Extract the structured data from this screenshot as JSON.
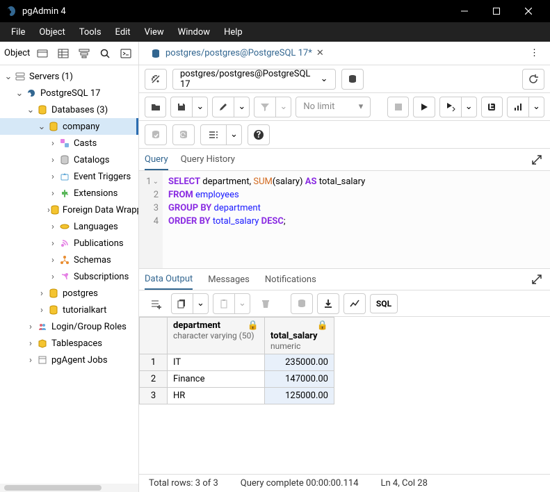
{
  "window": {
    "title": "pgAdmin 4"
  },
  "menu": [
    "File",
    "Object",
    "Tools",
    "Edit",
    "View",
    "Window",
    "Help"
  ],
  "sidebar_label": "Object",
  "tree": {
    "servers": "Servers (1)",
    "pg": "PostgreSQL 17",
    "databases": "Databases (3)",
    "company": "company",
    "casts": "Casts",
    "catalogs": "Catalogs",
    "event_triggers": "Event Triggers",
    "extensions": "Extensions",
    "fdw": "Foreign Data Wrappers",
    "languages": "Languages",
    "publications": "Publications",
    "schemas": "Schemas",
    "subscriptions": "Subscriptions",
    "postgres": "postgres",
    "tutorialkart": "tutorialkart",
    "login_roles": "Login/Group Roles",
    "tablespaces": "Tablespaces",
    "pgagent": "pgAgent Jobs"
  },
  "tab_title": "postgres/postgres@PostgreSQL 17*",
  "connection": "postgres/postgres@PostgreSQL 17",
  "no_limit": "No limit",
  "query_tabs": {
    "query": "Query",
    "history": "Query History"
  },
  "sql_lines": {
    "l1a": "SELECT",
    "l1b": " department, ",
    "l1c": "SUM",
    "l1d": "(salary) ",
    "l1e": "AS",
    "l1f": " total_salary",
    "l2a": "FROM",
    "l2b": " employees",
    "l3a": "GROUP BY",
    "l3b": " department",
    "l4a": "ORDER BY",
    "l4b": " total_salary ",
    "l4c": "DESC",
    "l4d": ";"
  },
  "out_tabs": {
    "data": "Data Output",
    "messages": "Messages",
    "notifications": "Notifications"
  },
  "sql_btn": "SQL",
  "columns": {
    "c1name": "department",
    "c1type": "character varying (50)",
    "c2name": "total_salary",
    "c2type": "numeric"
  },
  "rows": [
    {
      "n": "1",
      "dept": "IT",
      "sal": "235000.00"
    },
    {
      "n": "2",
      "dept": "Finance",
      "sal": "147000.00"
    },
    {
      "n": "3",
      "dept": "HR",
      "sal": "125000.00"
    }
  ],
  "status": {
    "rows": "Total rows: 3 of 3",
    "time": "Query complete 00:00:00.114",
    "pos": "Ln 4, Col 28"
  }
}
